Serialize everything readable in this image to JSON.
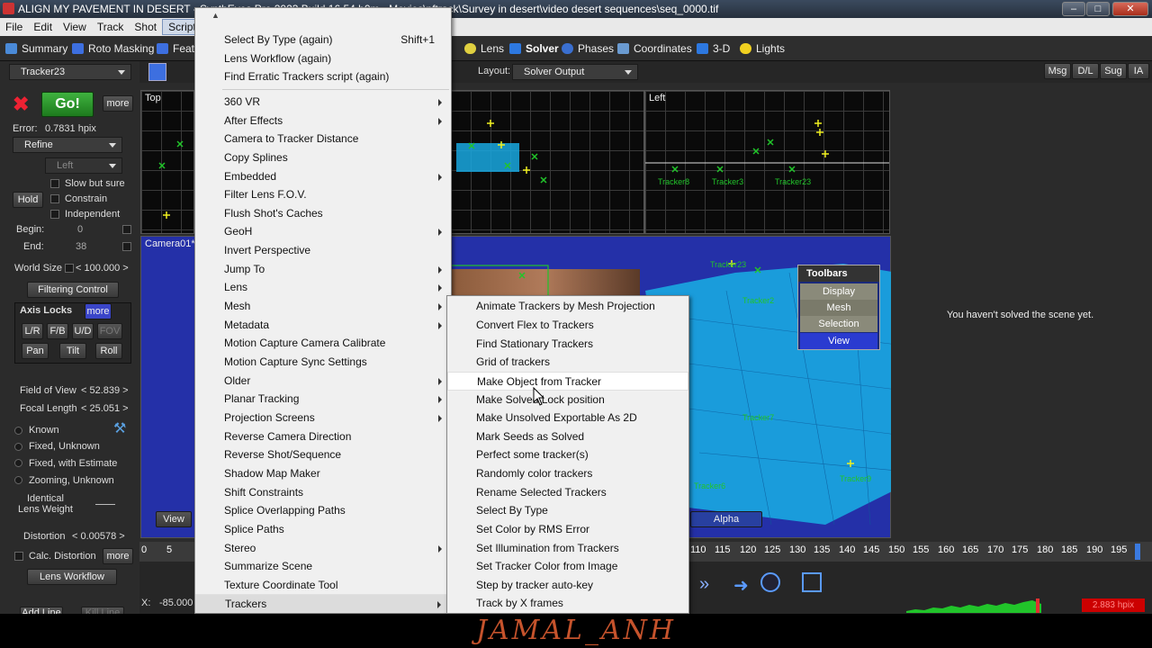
{
  "window": {
    "title": "ALIGN MY  PAVEMENT IN DESERT - SynthEyes Pro 2023 Build 16.54 b0m - Movies\\pftrack\\Survey in desert\\video desert sequences\\seq_0000.tif",
    "minimize": "–",
    "maximize": "□",
    "close": "✕"
  },
  "menubar": [
    "File",
    "Edit",
    "View",
    "Track",
    "Shot",
    "Script"
  ],
  "rooms": {
    "summary": "Summary",
    "roto": "Roto Masking",
    "feature": "Feat",
    "lens": "Lens",
    "solver": "Solver",
    "phases": "Phases",
    "coordinates": "Coordinates",
    "three_d": "3-D",
    "lights": "Lights"
  },
  "layout": {
    "label": "Layout:",
    "value": "Solver Output"
  },
  "right_buttons": [
    "Msg",
    "D/L",
    "Sug",
    "IA"
  ],
  "panel": {
    "tracker_select": "Tracker23",
    "go": "Go!",
    "more": "more",
    "error_label": "Error:",
    "error_value": "0.7831 hpix",
    "refine": "Refine",
    "left": "Left",
    "slow_but_sure": "Slow but sure",
    "hold": "Hold",
    "constrain": "Constrain",
    "independent": "Independent",
    "begin_label": "Begin:",
    "begin_value": "0",
    "end_label": "End:",
    "end_value": "38",
    "world_size_label": "World Size",
    "world_size_value": "< 100.000 >",
    "filtering_control": "Filtering Control",
    "axis_locks": "Axis Locks",
    "axis_more": "more",
    "lr": "L/R",
    "fb": "F/B",
    "ud": "U/D",
    "fov": "FOV",
    "pan": "Pan",
    "tilt": "Tilt",
    "roll": "Roll",
    "fov_label": "Field of View",
    "fov_value": "< 52.839 >",
    "focal_label": "Focal Length",
    "focal_value": "< 25.051 >",
    "lens_modes": [
      "Known",
      "Fixed, Unknown",
      "Fixed, with Estimate",
      "Zooming, Unknown"
    ],
    "identical_lens_weight": "Identical\nLens Weight",
    "distortion_label": "Distortion",
    "distortion_value": "< 0.00578 >",
    "calc_distortion": "Calc. Distortion",
    "calc_more": "more",
    "lens_workflow": "Lens Workflow",
    "x_label": "X:",
    "x_value": "-85.000",
    "add_line": "Add Line",
    "kill_line": "Kill Line"
  },
  "viewports": {
    "top": "Top",
    "left": "Left",
    "camera": "Camera01*",
    "view_button": "View",
    "alpha_button": "Alpha",
    "unsolved_message": "You haven't solved the scene yet."
  },
  "tracker_labels": [
    "Tracker8",
    "Tracker3",
    "Tracker23",
    "Tracker9",
    "Tracker7",
    "Tracker2",
    "Tracker6",
    "Tracker5"
  ],
  "toolbars_popup": {
    "title": "Toolbars",
    "items": [
      "Display",
      "Mesh",
      "Selection",
      "View"
    ]
  },
  "script_menu": [
    {
      "label": "Select By Type (again)",
      "shortcut": "Shift+1"
    },
    {
      "label": "Lens Workflow (again)"
    },
    {
      "label": "Find Erratic Trackers script (again)"
    },
    {
      "label": "360 VR",
      "sub": true
    },
    {
      "label": "After Effects",
      "sub": true
    },
    {
      "label": "Camera to Tracker Distance"
    },
    {
      "label": "Copy Splines"
    },
    {
      "label": "Embedded",
      "sub": true
    },
    {
      "label": "Filter Lens F.O.V."
    },
    {
      "label": "Flush Shot's Caches"
    },
    {
      "label": "GeoH",
      "sub": true
    },
    {
      "label": "Invert Perspective"
    },
    {
      "label": "Jump To",
      "sub": true
    },
    {
      "label": "Lens",
      "sub": true
    },
    {
      "label": "Mesh",
      "sub": true
    },
    {
      "label": "Metadata",
      "sub": true
    },
    {
      "label": "Motion Capture Camera Calibrate"
    },
    {
      "label": "Motion Capture Sync Settings"
    },
    {
      "label": "Older",
      "sub": true
    },
    {
      "label": "Planar Tracking",
      "sub": true
    },
    {
      "label": "Projection Screens",
      "sub": true
    },
    {
      "label": "Reverse Camera Direction"
    },
    {
      "label": "Reverse Shot/Sequence"
    },
    {
      "label": "Shadow Map Maker"
    },
    {
      "label": "Shift Constraints"
    },
    {
      "label": "Splice Overlapping Paths"
    },
    {
      "label": "Splice Paths"
    },
    {
      "label": "Stereo",
      "sub": true
    },
    {
      "label": "Summarize Scene"
    },
    {
      "label": "Texture Coordinate Tool"
    },
    {
      "label": "Trackers",
      "sub": true
    }
  ],
  "trackers_submenu": [
    "Animate Trackers by Mesh Projection",
    "Convert Flex to Trackers",
    "Find Stationary Trackers",
    "Grid of trackers",
    "Make Object from Tracker",
    "Make Solved Lock position",
    "Make Unsolved Exportable As 2D",
    "Mark Seeds as Solved",
    "Perfect some tracker(s)",
    "Randomly color trackers",
    "Rename Selected Trackers",
    "Select By Type",
    "Set Color by RMS Error",
    "Set Illumination from Trackers",
    "Set Tracker Color from Image",
    "Step by tracker auto-key",
    "Track by X frames"
  ],
  "timeline_ticks": [
    "0",
    "5",
    "110",
    "115",
    "120",
    "125",
    "130",
    "135",
    "140",
    "145",
    "150",
    "155",
    "160",
    "165",
    "170",
    "175",
    "180",
    "185",
    "190",
    "195"
  ],
  "status_value": "2.883 hpix",
  "watermark": "JAMAL_ANH",
  "colors": {
    "tracker_green": "#21c42a",
    "tracker_yellow": "#f0f020",
    "viewport_blue": "#2430a8",
    "mesh_cyan": "#19a8e0",
    "menu_bg": "#f0f0f0"
  }
}
